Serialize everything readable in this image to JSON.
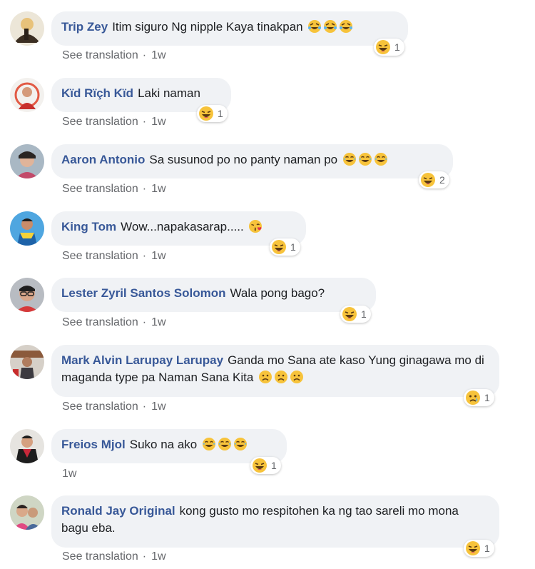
{
  "comments": [
    {
      "author": "Trip Zey",
      "text": "Itim siguro Ng nipple Kaya tinakpan",
      "emojis": [
        "rofl",
        "rofl",
        "rofl"
      ],
      "reaction": "haha",
      "count": "1",
      "see_translation": "See translation",
      "sep": "·",
      "time": "1w"
    },
    {
      "author": "Kïd Rïçh Kïd",
      "text": "Laki naman",
      "emojis": [],
      "reaction": "haha",
      "count": "1",
      "see_translation": "See translation",
      "sep": "·",
      "time": "1w"
    },
    {
      "author": "Aaron Antonio",
      "text": "Sa susunod po no panty naman po ",
      "emojis": [
        "joy",
        "joy",
        "joy"
      ],
      "reaction": "haha",
      "count": "2",
      "see_translation": "See translation",
      "sep": "·",
      "time": "1w"
    },
    {
      "author": "King Tom",
      "text": "Wow...napakasarap..... ",
      "emojis": [
        "kiss"
      ],
      "reaction": "haha",
      "count": "1",
      "see_translation": "See translation",
      "sep": "·",
      "time": "1w"
    },
    {
      "author": "Lester Zyril Santos Solomon",
      "text": "Wala pong bago?",
      "emojis": [],
      "reaction": "haha",
      "count": "1",
      "see_translation": "See translation",
      "sep": "·",
      "time": "1w"
    },
    {
      "author": "Mark Alvin Larupay Larupay",
      "text": "Ganda mo Sana ate kaso Yung ginagawa mo di maganda type pa Naman Sana Kita",
      "emojis": [
        "frown",
        "frown",
        "frown"
      ],
      "reaction": "sad",
      "count": "1",
      "see_translation": "See translation",
      "sep": "·",
      "time": "1w"
    },
    {
      "author": "Freios Mjol",
      "text": "Suko na ako",
      "emojis": [
        "joy",
        "joy",
        "joy"
      ],
      "reaction": "haha",
      "count": "1",
      "see_translation": "",
      "sep": "",
      "time": "1w"
    },
    {
      "author": "Ronald Jay Original",
      "text": "kong gusto mo respitohen ka ng tao sareli mo mona bagu eba.",
      "emojis": [],
      "reaction": "haha",
      "count": "1",
      "see_translation": "See translation",
      "sep": "·",
      "time": "1w"
    }
  ],
  "colors": {
    "author": "#385898",
    "bubble": "#f0f2f5",
    "meta": "#65676b",
    "emoji_yellow": "#f7c33b"
  }
}
